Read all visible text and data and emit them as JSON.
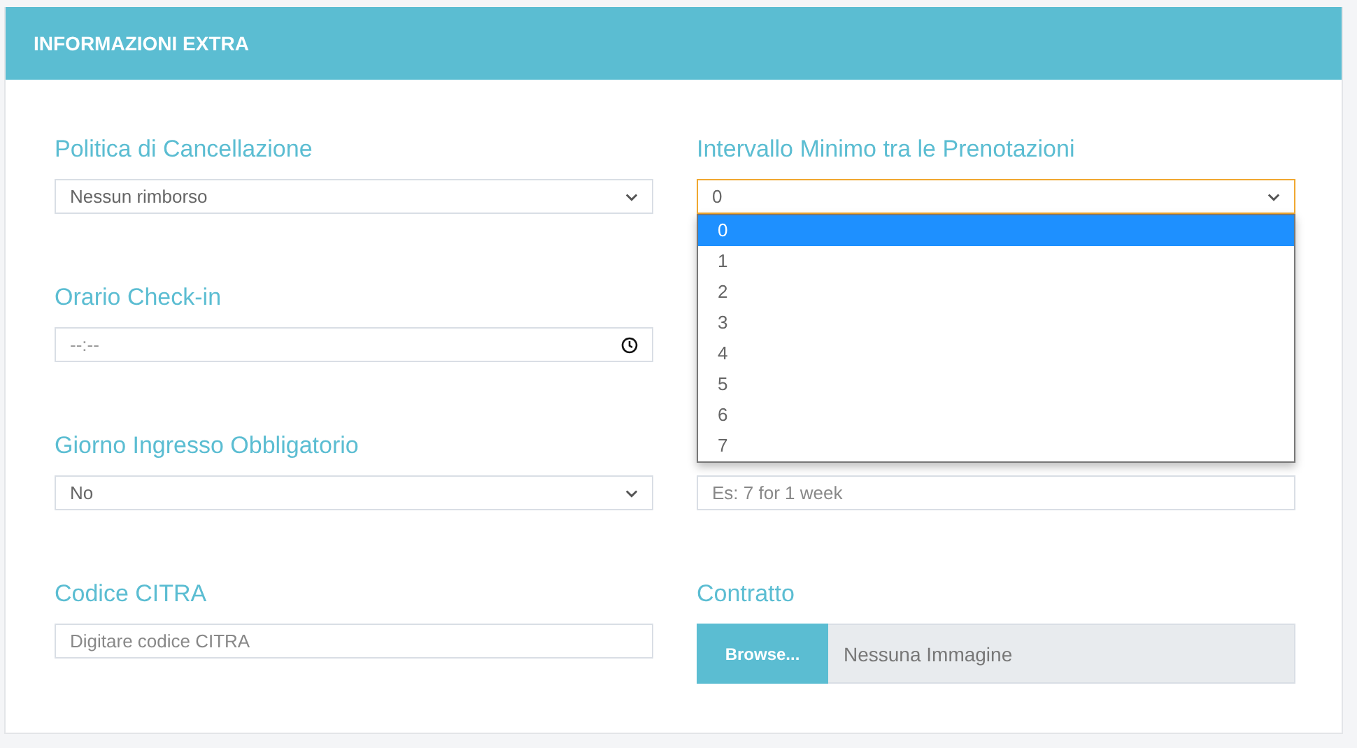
{
  "panel": {
    "title": "INFORMAZIONI EXTRA"
  },
  "rows": [
    {
      "left": {
        "kind": "select",
        "label": "Politica di Cancellazione",
        "value": "Nessun rimborso"
      },
      "right": {
        "kind": "select",
        "label": "Intervallo Minimo tra le Prenotazioni",
        "value": "0",
        "open": true,
        "options": [
          {
            "label": "0",
            "selected": true
          },
          {
            "label": "1",
            "selected": false
          },
          {
            "label": "2",
            "selected": false
          },
          {
            "label": "3",
            "selected": false
          },
          {
            "label": "4",
            "selected": false
          },
          {
            "label": "5",
            "selected": false
          },
          {
            "label": "6",
            "selected": false
          },
          {
            "label": "7",
            "selected": false
          }
        ]
      }
    },
    {
      "left": {
        "kind": "time",
        "label": "Orario Check-in",
        "placeholder": "--:--"
      }
    },
    {
      "left": {
        "kind": "select",
        "label": "Giorno Ingresso Obbligatorio",
        "value": "No"
      },
      "right": {
        "kind": "text",
        "placeholder": "Es: 7 for 1 week"
      }
    },
    {
      "left": {
        "kind": "text",
        "label": "Codice CITRA",
        "placeholder": "Digitare codice CITRA"
      },
      "right": {
        "kind": "file",
        "label": "Contratto",
        "button": "Browse...",
        "value": "Nessuna Immagine"
      }
    }
  ]
}
